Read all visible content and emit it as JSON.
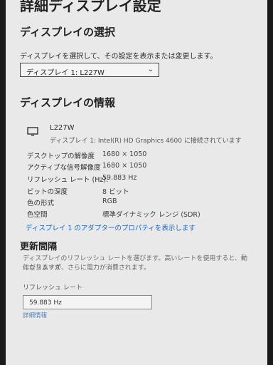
{
  "page": {
    "title": "詳細ディスプレイ設定"
  },
  "select_display": {
    "heading": "ディスプレイの選択",
    "description": "ディスプレイを選択して、その設定を表示または変更します。",
    "selected": "ディスプレイ 1: L227W"
  },
  "display_info": {
    "heading": "ディスプレイの情報",
    "monitor_name": "L227W",
    "connection": "ディスプレイ 1: Intel(R) HD Graphics 4600 に接続されています",
    "rows": [
      {
        "label": "デスクトップの解像度",
        "value": "1680 × 1050"
      },
      {
        "label": "アクティブな信号解像度",
        "value": "1680 × 1050"
      },
      {
        "label": "リフレッシュ レート (Hz):",
        "value": "59.883 Hz"
      },
      {
        "label": "ビットの深度",
        "value": "8 ビット"
      },
      {
        "label": "色の形式",
        "value": "RGB"
      },
      {
        "label": "色空間",
        "value": "標準ダイナミック レンジ (SDR)"
      }
    ],
    "adapter_link": "ディスプレイ 1 のアダプターのプロパティを表示します"
  },
  "refresh": {
    "heading": "更新間隔",
    "description_line1": "ディスプレイのリフレッシュ レートを選びます。高いレートを使用すると、動作がスムーズ",
    "description_line2": "になりますが、さらに電力が消費されます。",
    "field_label": "リフレッシュ レート",
    "selected": "59.883 Hz",
    "details_link": "詳細情報"
  },
  "icons": {
    "monitor": "monitor-icon",
    "dropdown": "chevron-down-icon"
  }
}
